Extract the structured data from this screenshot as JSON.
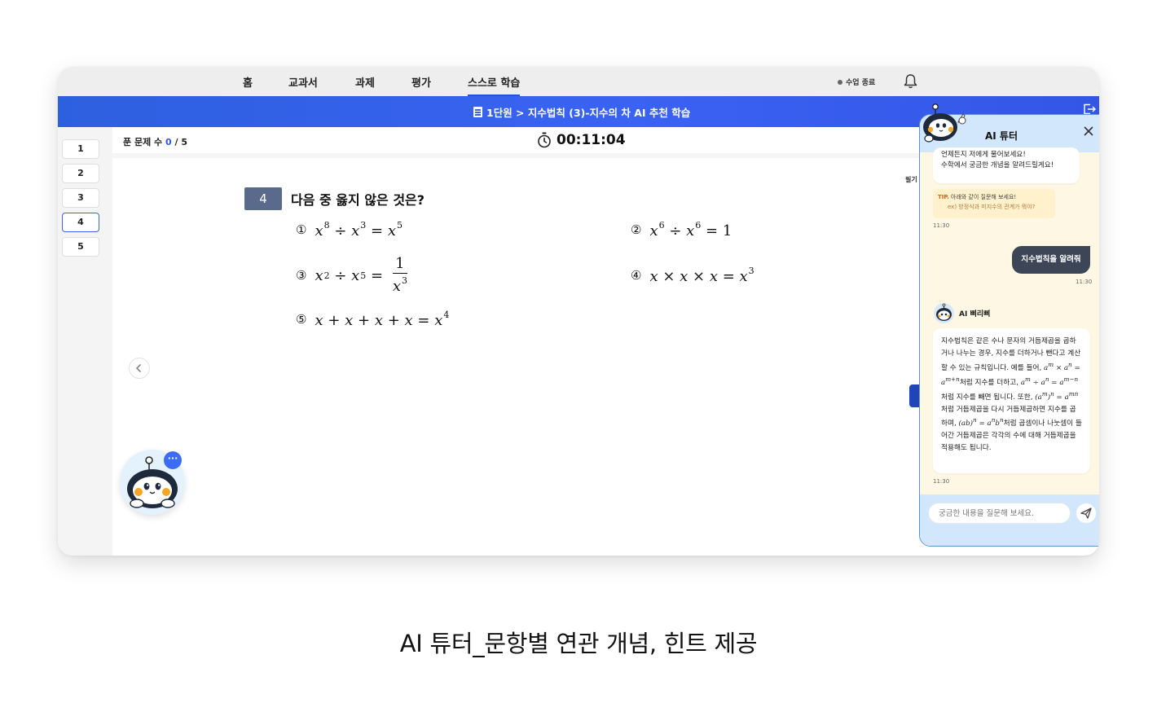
{
  "nav": {
    "items": [
      {
        "label": "홈"
      },
      {
        "label": "교과서"
      },
      {
        "label": "과제"
      },
      {
        "label": "평가"
      },
      {
        "label": "스스로 학습"
      }
    ],
    "active": "스스로 학습",
    "class_end": "수업 종료"
  },
  "breadcrumb": "1단원 > 지수법칙 (3)-지수의 차 AI 추천 학습",
  "sidebar": {
    "questions": [
      "1",
      "2",
      "3",
      "4",
      "5"
    ],
    "active": "4"
  },
  "progress": {
    "label": "푼 문제 수",
    "solved": "0",
    "total": "/ 5"
  },
  "timer": "00:11:04",
  "question": {
    "number": "4",
    "title": "다음 중 옳지 않은 것은?",
    "choice_marks": [
      "①",
      "②",
      "③",
      "④",
      "⑤"
    ]
  },
  "side_label": "필기",
  "tutor": {
    "title": "AI 튜터",
    "greeting_line1": "언제든지 저에게 물어보세요!",
    "greeting_line2": "수학에서 궁금한 개념을 알려드릴게요!",
    "tip_label": "TIP.",
    "tip_text": "아래와 같이 질문해 보세요!",
    "tip_example": "ex) 방정식과 미지수의 관계가 뭐야?",
    "time1": "11:30",
    "user_message": "지수법칙을 알려줘",
    "time2": "11:30",
    "bot_name": "AI 삐리삐",
    "answer_p1": "지수법칙은 같은 수나 문자의 거듭제곱을 곱하거나 나누는 경우, 지수를 더하거나 뺀다고 계산할 수 있는 규칙입니다. 예를 들어, ",
    "answer_p2": "처럼 지수를 더하고, ",
    "answer_p3": "처럼 지수를 빼면 됩니다. 또한, ",
    "answer_p4": "처럼 거듭제곱을 다시 거듭제곱하면 지수를 곱하며, ",
    "answer_p5": "처럼 곱셈이나 나눗셈이 들어간 거듭제곱은 각각의 수에 대해 거듭제곱을 적용해도 됩니다.",
    "time3": "11:30",
    "input_placeholder": "궁금한 내용을 질문해 보세요."
  },
  "caption": "AI 튜터_문항별 연관 개념, 힌트 제공",
  "colors": {
    "accent": "#3a62f3",
    "question_badge": "#5a6a8d",
    "tutor_header": "#d2e7fb",
    "tutor_body": "#fdf7e3"
  },
  "icons": [
    "bell-icon",
    "document-icon",
    "exit-icon",
    "timer-icon",
    "chevron-left-icon",
    "close-icon",
    "send-icon",
    "robot-mascot-icon",
    "more-icon"
  ]
}
